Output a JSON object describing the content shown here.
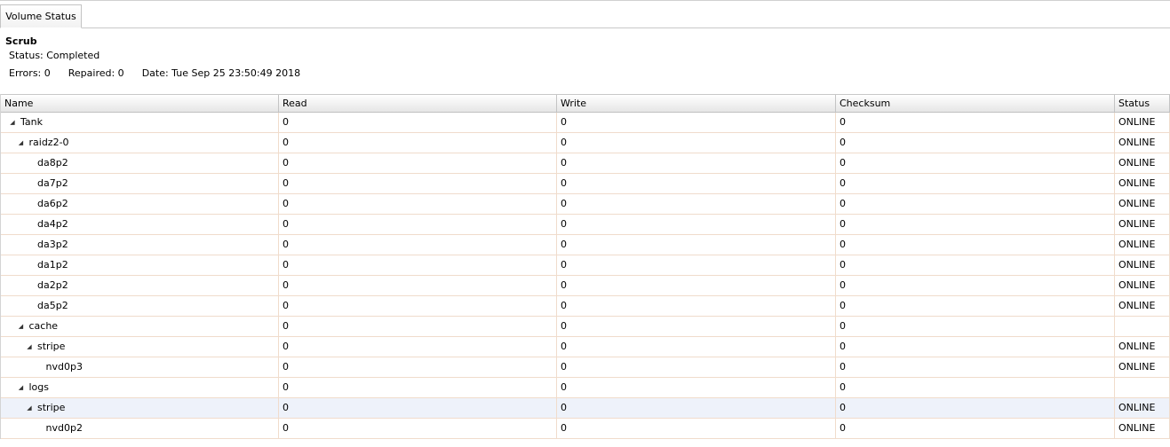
{
  "tab": {
    "label": "Volume Status"
  },
  "scrub": {
    "title": "Scrub",
    "status": "Status: Completed",
    "errors": "Errors: 0",
    "repaired": "Repaired: 0",
    "date": "Date: Tue Sep 25 23:50:49 2018"
  },
  "columns": [
    "Name",
    "Read",
    "Write",
    "Checksum",
    "Status"
  ],
  "rows": [
    {
      "name": "Tank",
      "level": 0,
      "expandable": true,
      "read": "0",
      "write": "0",
      "checksum": "0",
      "status": "ONLINE"
    },
    {
      "name": "raidz2-0",
      "level": 1,
      "expandable": true,
      "read": "0",
      "write": "0",
      "checksum": "0",
      "status": "ONLINE"
    },
    {
      "name": "da8p2",
      "level": 2,
      "expandable": false,
      "read": "0",
      "write": "0",
      "checksum": "0",
      "status": "ONLINE"
    },
    {
      "name": "da7p2",
      "level": 2,
      "expandable": false,
      "read": "0",
      "write": "0",
      "checksum": "0",
      "status": "ONLINE"
    },
    {
      "name": "da6p2",
      "level": 2,
      "expandable": false,
      "read": "0",
      "write": "0",
      "checksum": "0",
      "status": "ONLINE"
    },
    {
      "name": "da4p2",
      "level": 2,
      "expandable": false,
      "read": "0",
      "write": "0",
      "checksum": "0",
      "status": "ONLINE"
    },
    {
      "name": "da3p2",
      "level": 2,
      "expandable": false,
      "read": "0",
      "write": "0",
      "checksum": "0",
      "status": "ONLINE"
    },
    {
      "name": "da1p2",
      "level": 2,
      "expandable": false,
      "read": "0",
      "write": "0",
      "checksum": "0",
      "status": "ONLINE"
    },
    {
      "name": "da2p2",
      "level": 2,
      "expandable": false,
      "read": "0",
      "write": "0",
      "checksum": "0",
      "status": "ONLINE"
    },
    {
      "name": "da5p2",
      "level": 2,
      "expandable": false,
      "read": "0",
      "write": "0",
      "checksum": "0",
      "status": "ONLINE"
    },
    {
      "name": "cache",
      "level": 1,
      "expandable": true,
      "read": "0",
      "write": "0",
      "checksum": "0",
      "status": ""
    },
    {
      "name": "stripe",
      "level": 2,
      "expandable": true,
      "read": "0",
      "write": "0",
      "checksum": "0",
      "status": "ONLINE"
    },
    {
      "name": "nvd0p3",
      "level": 3,
      "expandable": false,
      "read": "0",
      "write": "0",
      "checksum": "0",
      "status": "ONLINE"
    },
    {
      "name": "logs",
      "level": 1,
      "expandable": true,
      "read": "0",
      "write": "0",
      "checksum": "0",
      "status": ""
    },
    {
      "name": "stripe",
      "level": 2,
      "expandable": true,
      "selected": true,
      "read": "0",
      "write": "0",
      "checksum": "0",
      "status": "ONLINE"
    },
    {
      "name": "nvd0p2",
      "level": 3,
      "expandable": false,
      "read": "0",
      "write": "0",
      "checksum": "0",
      "status": "ONLINE"
    }
  ],
  "icons": {
    "expanded": "triangle-expanded-icon"
  },
  "colors": {
    "row_border": "#f0dccc",
    "selected_row": "#eef2fa"
  }
}
